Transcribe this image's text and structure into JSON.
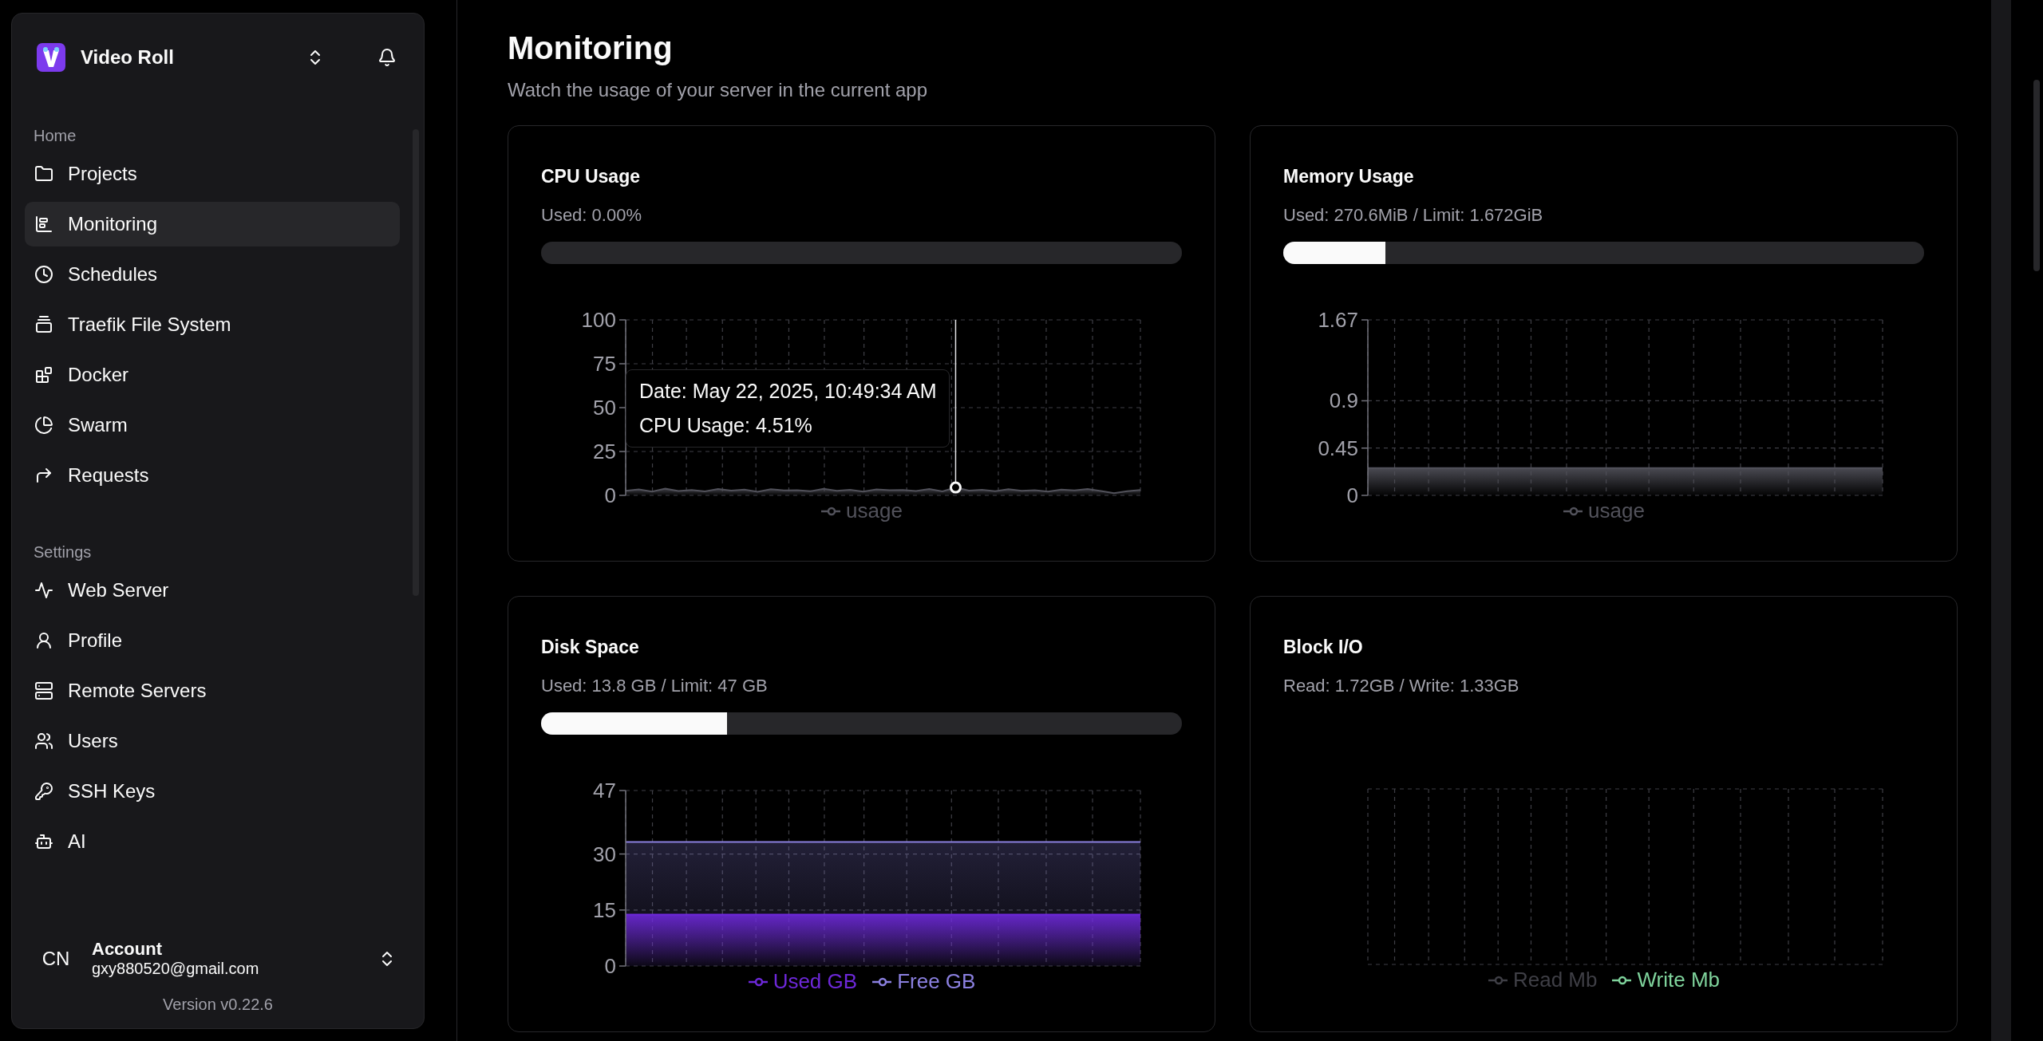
{
  "sidebar": {
    "app_name": "Video Roll",
    "sections": [
      {
        "label": "Home",
        "items": [
          {
            "label": "Projects",
            "selected": false
          },
          {
            "label": "Monitoring",
            "selected": true
          },
          {
            "label": "Schedules",
            "selected": false
          },
          {
            "label": "Traefik File System",
            "selected": false
          },
          {
            "label": "Docker",
            "selected": false
          },
          {
            "label": "Swarm",
            "selected": false
          },
          {
            "label": "Requests",
            "selected": false
          }
        ]
      },
      {
        "label": "Settings",
        "items": [
          {
            "label": "Web Server",
            "selected": false
          },
          {
            "label": "Profile",
            "selected": false
          },
          {
            "label": "Remote Servers",
            "selected": false
          },
          {
            "label": "Users",
            "selected": false
          },
          {
            "label": "SSH Keys",
            "selected": false
          },
          {
            "label": "AI",
            "selected": false
          }
        ]
      }
    ],
    "account": {
      "initials": "CN",
      "name": "Account",
      "email": "gxy880520@gmail.com"
    },
    "version": "Version v0.22.6"
  },
  "page": {
    "title": "Monitoring",
    "subtitle": "Watch the usage of your server in the current app"
  },
  "cards": [
    {
      "title": "CPU Usage",
      "reading": "Used: 0.00%",
      "level": 0,
      "chart_data": {
        "type": "area",
        "grid": true,
        "legend": "bottom",
        "ylim": [
          0,
          100
        ],
        "yticks": [
          0,
          25,
          50,
          75,
          100
        ],
        "series": [
          {
            "name": "usage",
            "color": "#52525b",
            "values": [
              2.6,
              3.4,
              2.2,
              3.8,
              2.5,
              3.1,
              2.3,
              3.6,
              2.7,
              3.3,
              2.1,
              3.5,
              2.8,
              3.0,
              2.4,
              3.7,
              2.6,
              3.2,
              2.2,
              3.4,
              2.9,
              3.1,
              2.5,
              3.6,
              2.3,
              4.5,
              2.7,
              3.2,
              2.4,
              3.5,
              2.6,
              3.0,
              2.2,
              3.3,
              2.8,
              3.6,
              2.5,
              1.2,
              2.4,
              3.1
            ]
          }
        ]
      },
      "tooltip": {
        "lines": [
          "Date: May 22, 2025, 10:49:34 AM",
          "CPU Usage: 4.51%"
        ]
      }
    },
    {
      "title": "Memory Usage",
      "reading": "Used: 270.6MiB / Limit: 1.672GiB",
      "level": 0.16,
      "chart_data": {
        "type": "area",
        "grid": true,
        "legend": "bottom",
        "ylim": [
          0,
          1.67
        ],
        "yticks": [
          0,
          0.45,
          0.9,
          1.67
        ],
        "series": [
          {
            "name": "usage",
            "color": "#52525b",
            "values": [
              0.26,
              0.26,
              0.26,
              0.26,
              0.26,
              0.26,
              0.26,
              0.26,
              0.26,
              0.26,
              0.26,
              0.26,
              0.26,
              0.26,
              0.26,
              0.26,
              0.26,
              0.26,
              0.26,
              0.26
            ]
          }
        ]
      }
    },
    {
      "title": "Disk Space",
      "reading": "Used: 13.8 GB / Limit: 47 GB",
      "level": 0.29,
      "chart_data": {
        "type": "area",
        "grid": true,
        "legend": "bottom",
        "ylim": [
          0,
          47
        ],
        "yticks": [
          0,
          15,
          30,
          47
        ],
        "series": [
          {
            "name": "Used GB",
            "color": "#6d28d9",
            "values": [
              13.8,
              13.8,
              13.8,
              13.8,
              13.8,
              13.8,
              13.8,
              13.8,
              13.8,
              13.8,
              13.8,
              13.8,
              13.8,
              13.8,
              13.8,
              13.8,
              13.8,
              13.8,
              13.8,
              13.8
            ]
          },
          {
            "name": "Free GB",
            "color": "#8b80e0",
            "values": [
              33.2,
              33.2,
              33.2,
              33.2,
              33.2,
              33.2,
              33.2,
              33.2,
              33.2,
              33.2,
              33.2,
              33.2,
              33.2,
              33.2,
              33.2,
              33.2,
              33.2,
              33.2,
              33.2,
              33.2
            ]
          }
        ]
      }
    },
    {
      "title": "Block I/O",
      "reading": "Read: 1.72GB / Write: 1.33GB",
      "empty_chart": {
        "legend": [
          {
            "name": "Read Mb",
            "color": "#3f3f46"
          },
          {
            "name": "Write Mb",
            "color": "#7fd39c"
          }
        ]
      }
    }
  ]
}
